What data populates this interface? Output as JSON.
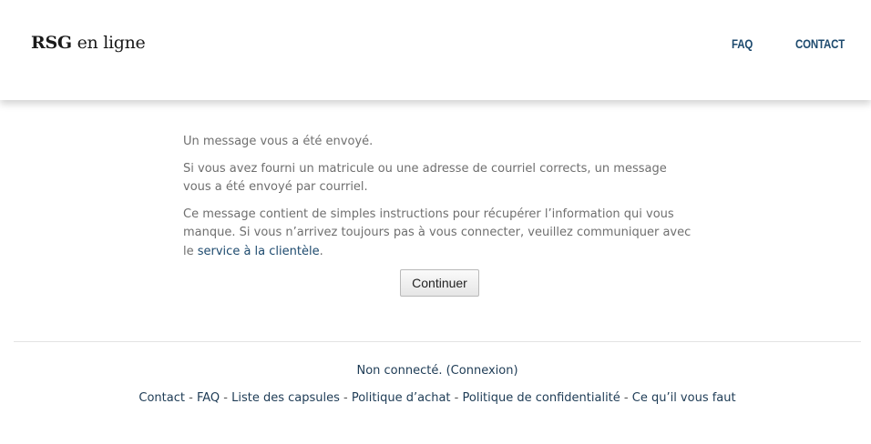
{
  "header": {
    "logo_bold": "RSG",
    "logo_rest": " en ligne",
    "nav": {
      "faq": "FAQ",
      "contact": "CONTACT"
    }
  },
  "main": {
    "p1": "Un message vous a été envoyé.",
    "p2": "Si vous avez fourni un matricule ou une adresse de courriel corrects, un message vous a été envoyé par courriel.",
    "p3_text": "Ce message contient de simples instructions pour récupérer l’information qui vous manque. Si vous n’arrivez toujours pas à vous connecter, veuillez communiquer avec le ",
    "p3_link": "service à la clientèle",
    "p3_end": ".",
    "continue_label": "Continuer"
  },
  "footer": {
    "status_text": "Non connecté. ",
    "login_link": "(Connexion)",
    "links": [
      "Contact",
      "FAQ",
      "Liste des capsules",
      "Politique d’achat",
      "Politique de confidentialité",
      "Ce qu’il vous faut"
    ],
    "separator": " - "
  },
  "colors": {
    "link": "#1d4a6e",
    "text": "#6f6f6f",
    "logo": "#1a1a1a"
  }
}
